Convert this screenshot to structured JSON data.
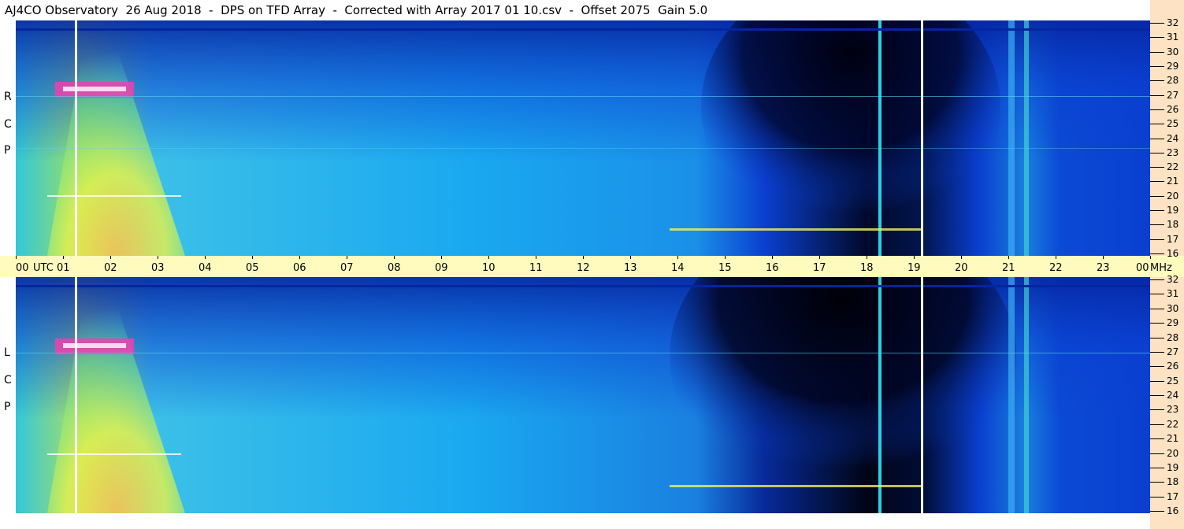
{
  "title": "AJ4CO Observatory  26 Aug 2018  -  DPS on TFD Array  -  Corrected with Array 2017 01 10.csv  -  Offset 2075  Gain 5.0",
  "chart_data": [
    {
      "type": "heatmap",
      "panel": "RCP",
      "polarization_label": [
        "R",
        "C",
        "P"
      ],
      "x_unit": "UTC",
      "x_ticks": [
        "00",
        "01",
        "02",
        "03",
        "04",
        "05",
        "06",
        "07",
        "08",
        "09",
        "10",
        "11",
        "12",
        "13",
        "14",
        "15",
        "16",
        "17",
        "18",
        "19",
        "20",
        "21",
        "22",
        "23",
        "00"
      ],
      "y_unit": "MHz",
      "y_ticks": [
        32,
        31,
        30,
        29,
        28,
        27,
        26,
        25,
        24,
        23,
        22,
        21,
        20,
        19,
        18,
        17,
        16
      ],
      "ylim": [
        16,
        32
      ],
      "xlim_hours": [
        0,
        24
      ]
    },
    {
      "type": "heatmap",
      "panel": "LCP",
      "polarization_label": [
        "L",
        "C",
        "P"
      ],
      "x_unit": "UTC",
      "x_ticks": [
        "00",
        "01",
        "02",
        "03",
        "04",
        "05",
        "06",
        "07",
        "08",
        "09",
        "10",
        "11",
        "12",
        "13",
        "14",
        "15",
        "16",
        "17",
        "18",
        "19",
        "20",
        "21",
        "22",
        "23",
        "00"
      ],
      "y_unit": "MHz",
      "y_ticks": [
        32,
        31,
        30,
        29,
        28,
        27,
        26,
        25,
        24,
        23,
        22,
        21,
        20,
        19,
        18,
        17,
        16
      ],
      "ylim": [
        16,
        32
      ],
      "xlim_hours": [
        0,
        24
      ]
    }
  ],
  "axis": {
    "utc_label": "UTC",
    "mhz_label": "MHz"
  },
  "markers_utc": [
    1.25,
    19.15
  ],
  "colors": {
    "background_deep": "#0a3fd0",
    "background_mid": "#1aa8f0",
    "dark_night": "#000820",
    "hot": "#f0f040",
    "axis_band": "#fffbbf",
    "side_strip": "#fde3c3"
  }
}
